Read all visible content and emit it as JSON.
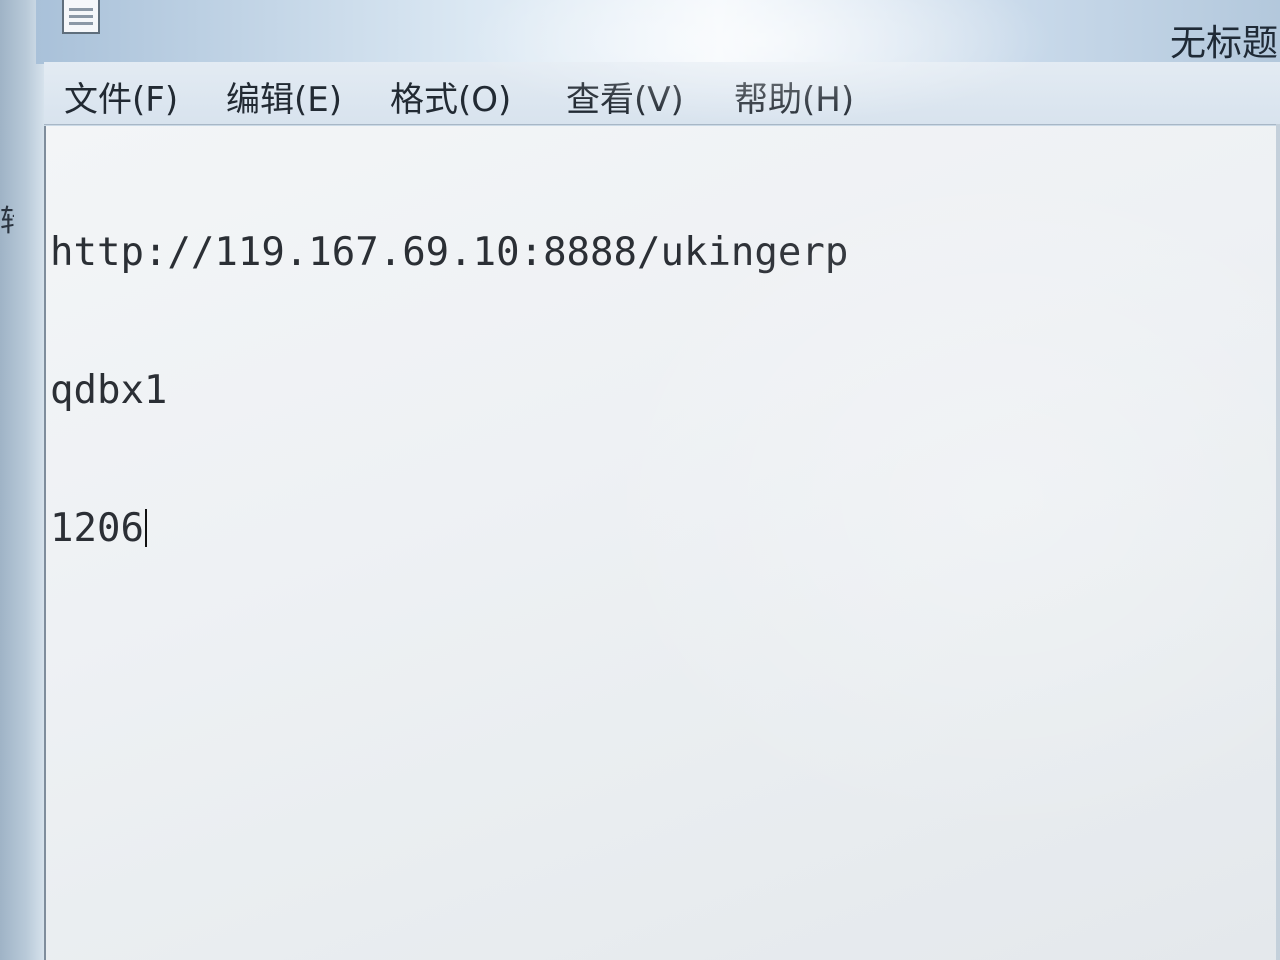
{
  "window": {
    "title": "无标题",
    "app_icon": "notepad-icon"
  },
  "menu": {
    "items": [
      {
        "label": "文件(F)"
      },
      {
        "label": "编辑(E)"
      },
      {
        "label": "格式(O)"
      },
      {
        "label": "查看(V)"
      },
      {
        "label": "帮助(H)"
      }
    ]
  },
  "editor": {
    "lines": [
      "http://119.167.69.10:8888/ukingerp",
      "qdbx1",
      "1206"
    ]
  },
  "background": {
    "left_strip_glyph": "转"
  }
}
